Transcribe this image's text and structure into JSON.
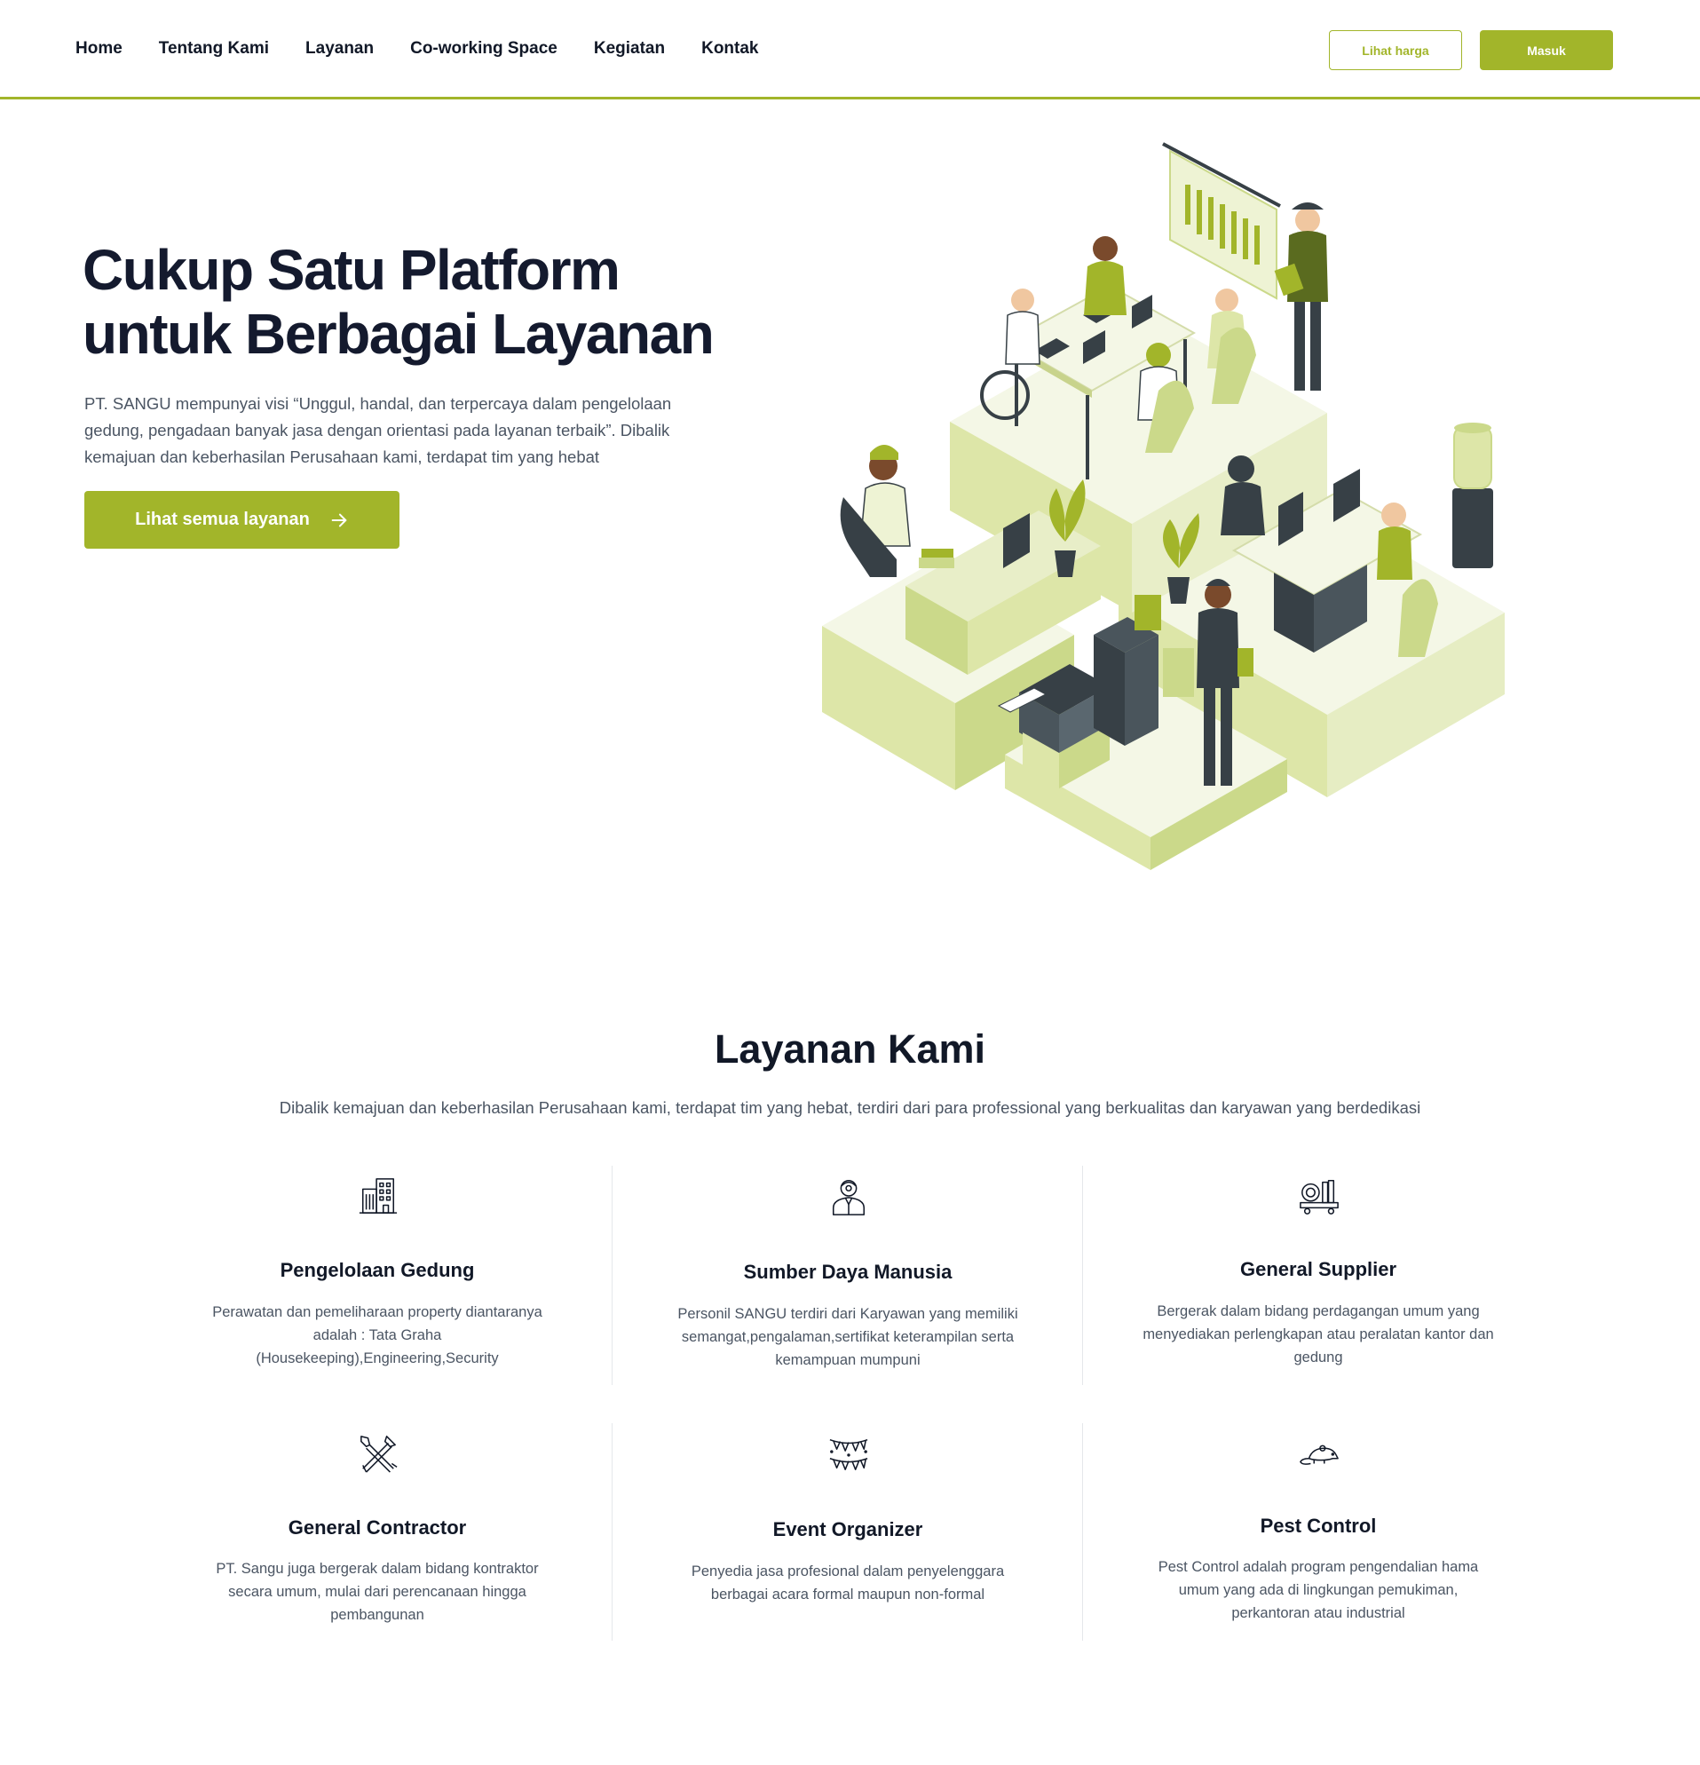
{
  "nav": {
    "links": [
      "Home",
      "Tentang Kami",
      "Layanan",
      "Co-working Space",
      "Kegiatan",
      "Kontak"
    ],
    "btn_price": "Lihat harga",
    "btn_login": "Masuk"
  },
  "hero": {
    "title_line1": "Cukup Satu Platform",
    "title_line2": "untuk Berbagai Layanan",
    "description": "PT. SANGU mempunyai visi “Unggul, handal, dan terpercaya dalam pengelolaan gedung, pengadaan banyak jasa dengan orientasi pada layanan terbaik”. Dibalik kemajuan dan keberhasilan Perusahaan kami, terdapat tim yang hebat",
    "cta_label": "Lihat semua layanan"
  },
  "services": {
    "title": "Layanan Kami",
    "subtitle": "Dibalik kemajuan dan keberhasilan Perusahaan kami, terdapat tim yang hebat, terdiri dari para professional yang berkualitas dan karyawan yang berdedikasi",
    "items": [
      {
        "icon": "building-icon",
        "title": "Pengelolaan Gedung",
        "desc": "Perawatan dan pemeliharaan property diantaranya adalah : Tata Graha (Housekeeping),Engineering,Security"
      },
      {
        "icon": "person-icon",
        "title": "Sumber Daya Manusia",
        "desc": "Personil SANGU terdiri dari Karyawan yang memiliki semangat,pengalaman,sertifikat keterampilan serta kemampuan mumpuni"
      },
      {
        "icon": "supply-icon",
        "title": "General Supplier",
        "desc": "Bergerak dalam bidang perdagangan umum yang menyediakan perlengkapan atau peralatan kantor dan gedung"
      },
      {
        "icon": "tools-icon",
        "title": "General Contractor",
        "desc": "PT. Sangu juga bergerak dalam bidang kontraktor secara umum, mulai dari perencanaan hingga pembangunan"
      },
      {
        "icon": "bunting-icon",
        "title": "Event Organizer",
        "desc": "Penyedia jasa profesional dalam penyelenggara berbagai acara formal maupun non-formal"
      },
      {
        "icon": "rat-icon",
        "title": "Pest Control",
        "desc": "Pest Control adalah program pengendalian hama umum yang ada di lingkungan pemukiman, perkantoran atau industrial"
      }
    ]
  },
  "colors": {
    "accent": "#a2b52a",
    "heading": "#141a2e",
    "body_text": "#4b5563"
  }
}
